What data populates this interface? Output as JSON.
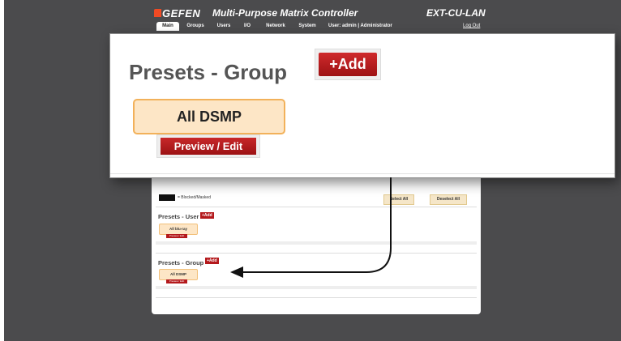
{
  "header": {
    "brand": "GEFEN",
    "app_title": "Multi-Purpose Matrix Controller",
    "device": "EXT-CU-LAN",
    "tabs": [
      {
        "label": "Main",
        "active": true
      },
      {
        "label": "Groups"
      },
      {
        "label": "Users"
      },
      {
        "label": "I/O"
      },
      {
        "label": "Network"
      },
      {
        "label": "System"
      }
    ],
    "user_info": "User: admin  |  Administrator",
    "logout": "Log Out"
  },
  "page": {
    "legend": "= Blocked/Masked",
    "select_all": "Select All",
    "deselect_all": "Deselect All",
    "presets_user": {
      "title": "Presets - User",
      "add": "+Add",
      "card": "All blu-ray",
      "preview": "Preview / Edit"
    },
    "presets_group": {
      "title": "Presets - Group",
      "add": "+Add",
      "card": "All DSMP",
      "preview": "Preview / Edit"
    }
  },
  "zoom": {
    "title": "Presets - Group",
    "add": "+Add",
    "card": "All DSMP",
    "preview": "Preview / Edit"
  },
  "colors": {
    "background": "#4b4b4d",
    "accent_red": "#b4191c",
    "card_fill": "#fde6c6",
    "brand_orange": "#f04a24"
  }
}
